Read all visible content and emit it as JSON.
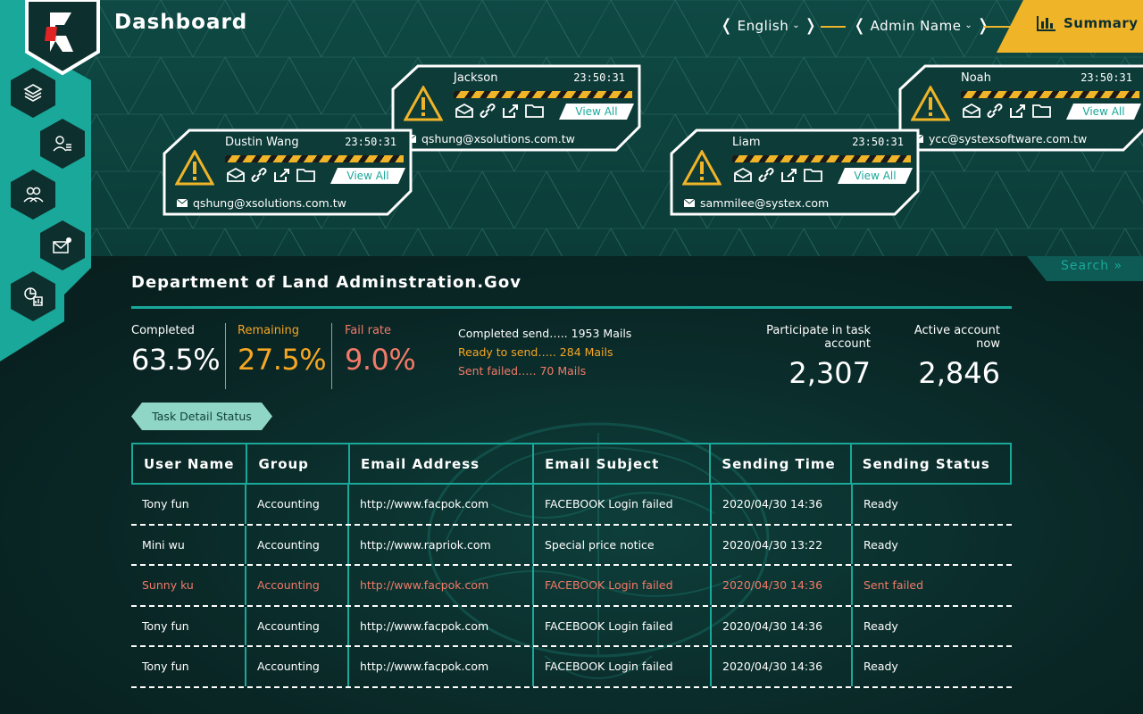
{
  "header": {
    "title": "Dashboard",
    "language": "English",
    "admin": "Admin Name",
    "summary_label": "Summary"
  },
  "colors": {
    "accent": "#1aa89a",
    "warning": "#f0b429",
    "remaining": "#f6a623",
    "fail": "#f27a68",
    "panel": "#0d3b38"
  },
  "sidebar": {
    "items": [
      {
        "icon": "layers-icon"
      },
      {
        "icon": "user-list-icon"
      },
      {
        "icon": "users-icon"
      },
      {
        "icon": "mail-settings-icon"
      },
      {
        "icon": "report-chart-icon"
      }
    ]
  },
  "alerts": [
    {
      "name": "Jackson",
      "time": "23:50:31",
      "email": "qshung@xsolutions.com.tw",
      "button": "View All"
    },
    {
      "name": "Dustin Wang",
      "time": "23:50:31",
      "email": "qshung@xsolutions.com.tw",
      "button": "View All"
    },
    {
      "name": "Noah",
      "time": "23:50:31",
      "email": "ycc@systexsoftware.com.tw",
      "button": "View All"
    },
    {
      "name": "Liam",
      "time": "23:50:31",
      "email": "sammilee@systex.com",
      "button": "View All"
    }
  ],
  "search_label": "Search »",
  "department": {
    "title": "Department of Land Adminstration.Gov",
    "completed_label": "Completed",
    "completed_value": "63.5%",
    "remaining_label": "Remaining",
    "remaining_value": "27.5%",
    "fail_label": "Fail rate",
    "fail_value": "9.0%",
    "mail_lines": [
      "Completed send….. 1953 Mails",
      "Ready to send….. 284 Mails",
      "Sent failed….. 70 Mails"
    ],
    "participate_label": "Participate in task account",
    "participate_value": "2,307",
    "active_label": "Active account now",
    "active_value": "2,846",
    "task_button": "Task Detail Status"
  },
  "table": {
    "headers": [
      "User Name",
      "Group",
      "Email Address",
      "Email Subject",
      "Sending Time",
      "Sending Status"
    ],
    "rows": [
      {
        "user": "Tony fun",
        "group": "Accounting",
        "email": "http://www.facpok.com",
        "subject": "FACEBOOK Login failed",
        "time": "2020/04/30 14:36",
        "status": "Ready"
      },
      {
        "user": "Mini wu",
        "group": "Accounting",
        "email": "http://www.rapriok.com",
        "subject": "Special price notice",
        "time": "2020/04/30 13:22",
        "status": "Ready"
      },
      {
        "user": "Sunny ku",
        "group": "Accounting",
        "email": "http://www.facpok.com",
        "subject": "FACEBOOK Login failed",
        "time": "2020/04/30 14:36",
        "status": "Sent failed"
      },
      {
        "user": "Tony fun",
        "group": "Accounting",
        "email": "http://www.facpok.com",
        "subject": "FACEBOOK Login failed",
        "time": "2020/04/30 14:36",
        "status": "Ready"
      },
      {
        "user": "Tony fun",
        "group": "Accounting",
        "email": "http://www.facpok.com",
        "subject": "FACEBOOK Login failed",
        "time": "2020/04/30 14:36",
        "status": "Ready"
      }
    ]
  }
}
